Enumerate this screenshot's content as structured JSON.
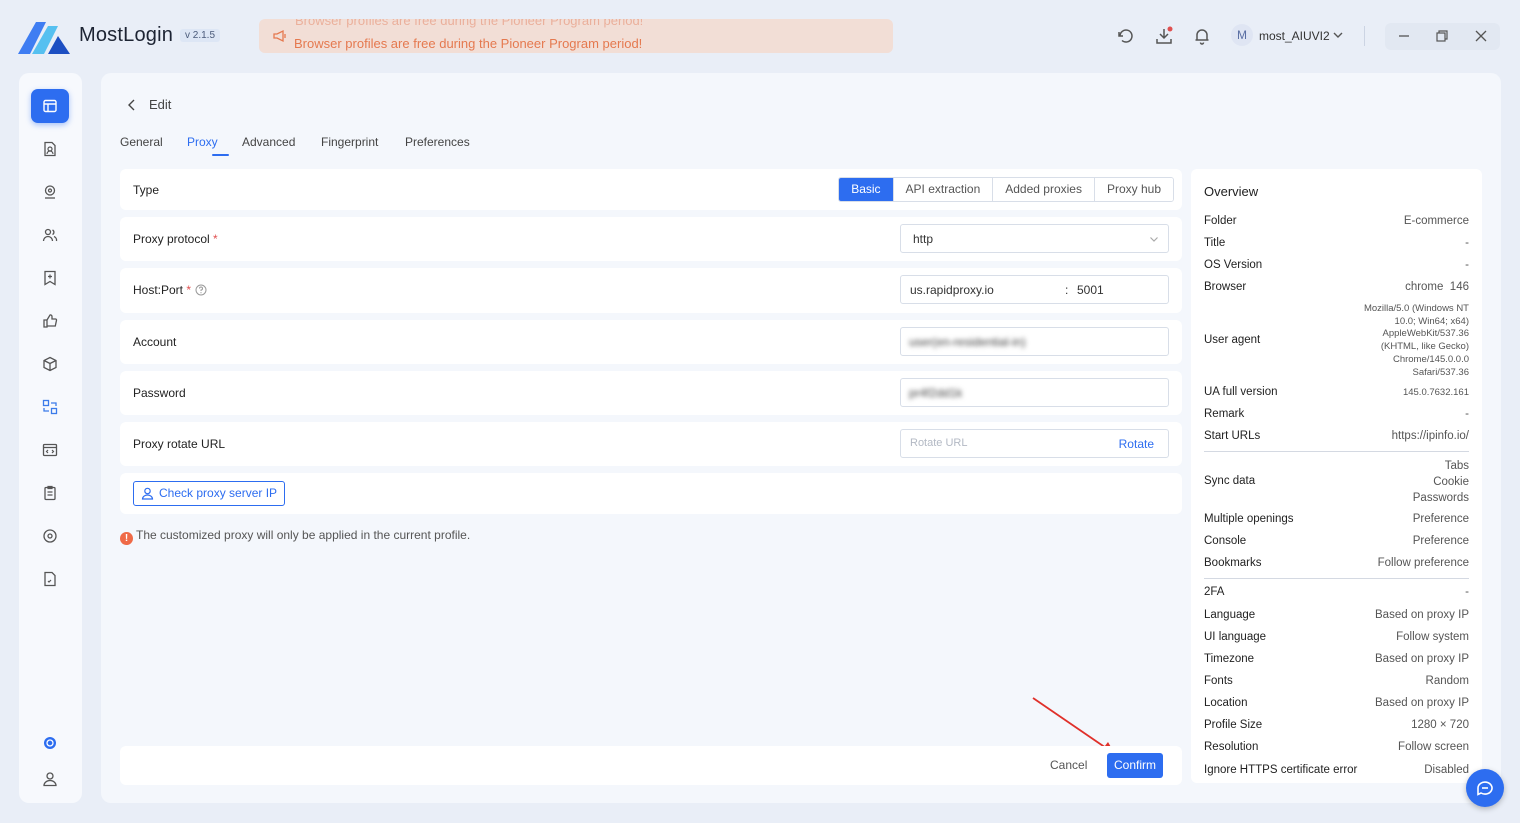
{
  "app": {
    "name": "MostLogin",
    "version": "v 2.1.5",
    "banner_top": "Browser profiles are free during the Pioneer Program period!",
    "banner": "Browser profiles are free during the Pioneer Program period!",
    "user_initial": "M",
    "username": "most_AIUVI2"
  },
  "page": {
    "title": "Edit",
    "tabs": [
      "General",
      "Proxy",
      "Advanced",
      "Fingerprint",
      "Preferences"
    ],
    "active_tab": "Proxy"
  },
  "proxy": {
    "type_label": "Type",
    "type_options": [
      "Basic",
      "API extraction",
      "Added proxies",
      "Proxy hub"
    ],
    "protocol_label": "Proxy protocol",
    "protocol_value": "http",
    "hostport_label": "Host:Port",
    "host_value": "us.rapidproxy.io",
    "port_sep": ":",
    "port_value": "5001",
    "account_label": "Account",
    "account_value": "user(en-residential-in)",
    "password_label": "Password",
    "password_value": "pr4f2dd1k",
    "rotate_label": "Proxy rotate URL",
    "rotate_placeholder": "Rotate URL",
    "rotate_link": "Rotate",
    "check_btn": "Check proxy server IP",
    "required_mark": "*",
    "notice_icon": "!",
    "notice": "The customized proxy will only be applied in the current profile."
  },
  "footer": {
    "cancel": "Cancel",
    "confirm": "Confirm"
  },
  "overview": {
    "title": "Overview",
    "folder_k": "Folder",
    "folder_v": "E-commerce",
    "title_k": "Title",
    "title_v": "-",
    "os_k": "OS Version",
    "os_v": "-",
    "browser_k": "Browser",
    "browser_v": "chrome  146",
    "ua_k": "User agent",
    "ua_lines": [
      "Mozilla/5.0 (Windows NT",
      "10.0; Win64; x64)",
      "AppleWebKit/537.36",
      "(KHTML, like Gecko)",
      "Chrome/145.0.0.0",
      "Safari/537.36"
    ],
    "uafull_k": "UA full version",
    "uafull_v": "145.0.7632.161",
    "remark_k": "Remark",
    "remark_v": "-",
    "start_k": "Start URLs",
    "start_v": "https://ipinfo.io/",
    "sync_k": "Sync data",
    "sync_v": [
      "Tabs",
      "Cookie",
      "Passwords"
    ],
    "multi_k": "Multiple openings",
    "multi_v": "Preference",
    "console_k": "Console",
    "console_v": "Preference",
    "bookmarks_k": "Bookmarks",
    "bookmarks_v": "Follow preference",
    "twofa_k": "2FA",
    "twofa_v": "-",
    "lang_k": "Language",
    "lang_v": "Based on proxy IP",
    "uilang_k": "UI language",
    "uilang_v": "Follow system",
    "tz_k": "Timezone",
    "tz_v": "Based on proxy IP",
    "fonts_k": "Fonts",
    "fonts_v": "Random",
    "loc_k": "Location",
    "loc_v": "Based on proxy IP",
    "size_k": "Profile Size",
    "size_v": "1280 × 720",
    "res_k": "Resolution",
    "res_v": "Follow screen",
    "https_k": "Ignore HTTPS certificate error",
    "https_v": "Disabled"
  },
  "colors": {
    "accent": "#2d6df0",
    "banner_bg": "#f2ded6",
    "banner_text": "#e5794f",
    "annotation_arrow": "#e0302a"
  },
  "icons": {
    "rail": [
      "browser-profile-icon",
      "profile-edit-icon",
      "proxy-location-icon",
      "team-icon",
      "bookmark-add-icon",
      "thumbs-up-icon",
      "extension-cube-icon",
      "automation-icon",
      "api-icon",
      "clipboard-icon",
      "settings-icon",
      "document-icon",
      "status-icon",
      "account-icon"
    ]
  }
}
